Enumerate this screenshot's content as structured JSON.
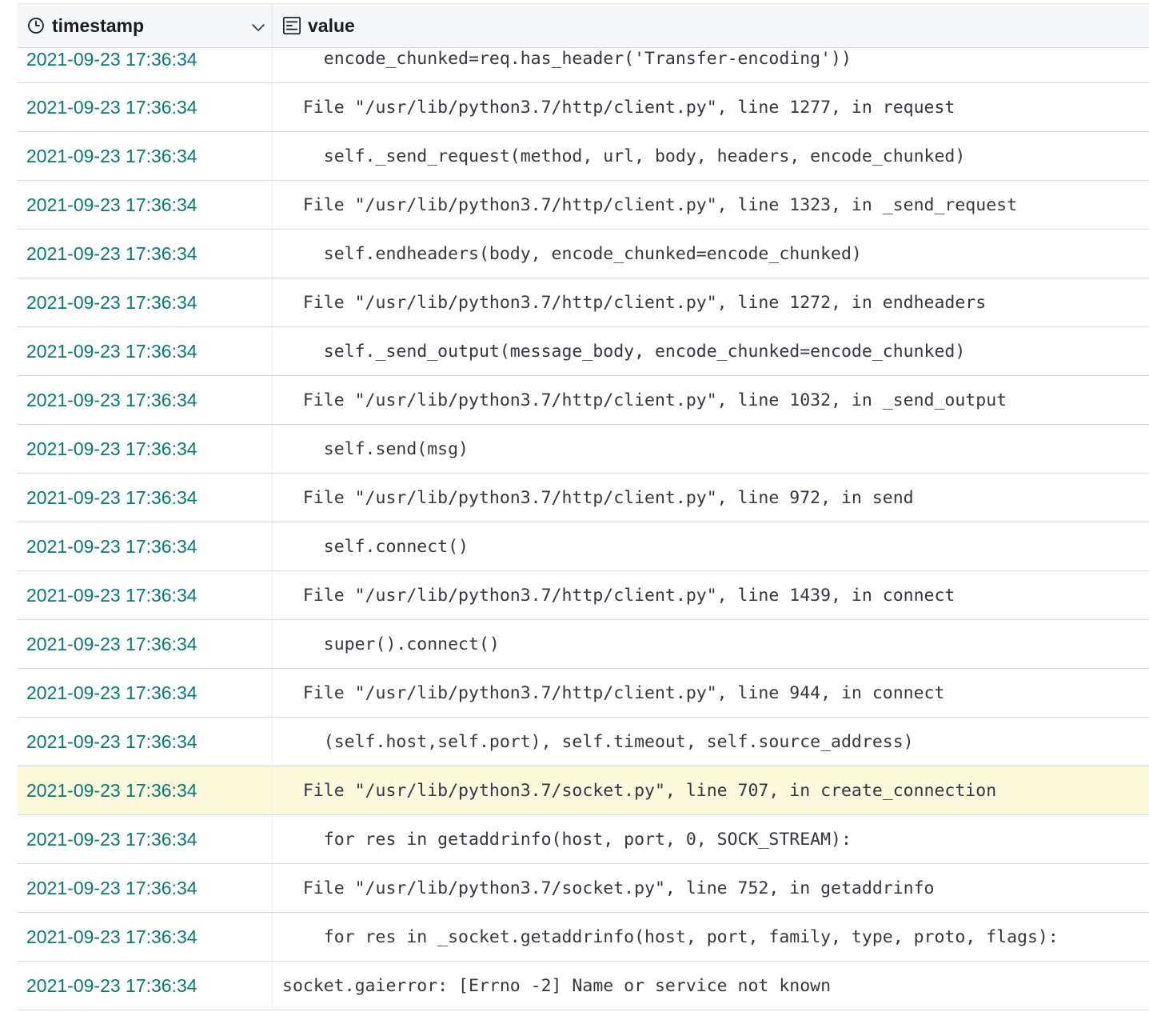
{
  "columns": {
    "timestamp": {
      "label": "timestamp",
      "icon": "clock-icon"
    },
    "value": {
      "label": "value",
      "icon": "text-field-icon"
    },
    "sort_icon": "chevron-down-icon"
  },
  "colors": {
    "timestamp_text": "#017d73",
    "highlight_row": "#fcf9dd"
  },
  "rows": [
    {
      "timestamp": "2021-09-23 17:36:34",
      "value": "    encode_chunked=req.has_header('Transfer-encoding'))"
    },
    {
      "timestamp": "2021-09-23 17:36:34",
      "value": "  File \"/usr/lib/python3.7/http/client.py\", line 1277, in request"
    },
    {
      "timestamp": "2021-09-23 17:36:34",
      "value": "    self._send_request(method, url, body, headers, encode_chunked)"
    },
    {
      "timestamp": "2021-09-23 17:36:34",
      "value": "  File \"/usr/lib/python3.7/http/client.py\", line 1323, in _send_request"
    },
    {
      "timestamp": "2021-09-23 17:36:34",
      "value": "    self.endheaders(body, encode_chunked=encode_chunked)"
    },
    {
      "timestamp": "2021-09-23 17:36:34",
      "value": "  File \"/usr/lib/python3.7/http/client.py\", line 1272, in endheaders"
    },
    {
      "timestamp": "2021-09-23 17:36:34",
      "value": "    self._send_output(message_body, encode_chunked=encode_chunked)"
    },
    {
      "timestamp": "2021-09-23 17:36:34",
      "value": "  File \"/usr/lib/python3.7/http/client.py\", line 1032, in _send_output"
    },
    {
      "timestamp": "2021-09-23 17:36:34",
      "value": "    self.send(msg)"
    },
    {
      "timestamp": "2021-09-23 17:36:34",
      "value": "  File \"/usr/lib/python3.7/http/client.py\", line 972, in send"
    },
    {
      "timestamp": "2021-09-23 17:36:34",
      "value": "    self.connect()"
    },
    {
      "timestamp": "2021-09-23 17:36:34",
      "value": "  File \"/usr/lib/python3.7/http/client.py\", line 1439, in connect"
    },
    {
      "timestamp": "2021-09-23 17:36:34",
      "value": "    super().connect()"
    },
    {
      "timestamp": "2021-09-23 17:36:34",
      "value": "  File \"/usr/lib/python3.7/http/client.py\", line 944, in connect"
    },
    {
      "timestamp": "2021-09-23 17:36:34",
      "value": "    (self.host,self.port), self.timeout, self.source_address)"
    },
    {
      "timestamp": "2021-09-23 17:36:34",
      "value": "  File \"/usr/lib/python3.7/socket.py\", line 707, in create_connection",
      "highlighted": true
    },
    {
      "timestamp": "2021-09-23 17:36:34",
      "value": "    for res in getaddrinfo(host, port, 0, SOCK_STREAM):"
    },
    {
      "timestamp": "2021-09-23 17:36:34",
      "value": "  File \"/usr/lib/python3.7/socket.py\", line 752, in getaddrinfo"
    },
    {
      "timestamp": "2021-09-23 17:36:34",
      "value": "    for res in _socket.getaddrinfo(host, port, family, type, proto, flags):"
    },
    {
      "timestamp": "2021-09-23 17:36:34",
      "value": "socket.gaierror: [Errno -2] Name or service not known"
    }
  ]
}
